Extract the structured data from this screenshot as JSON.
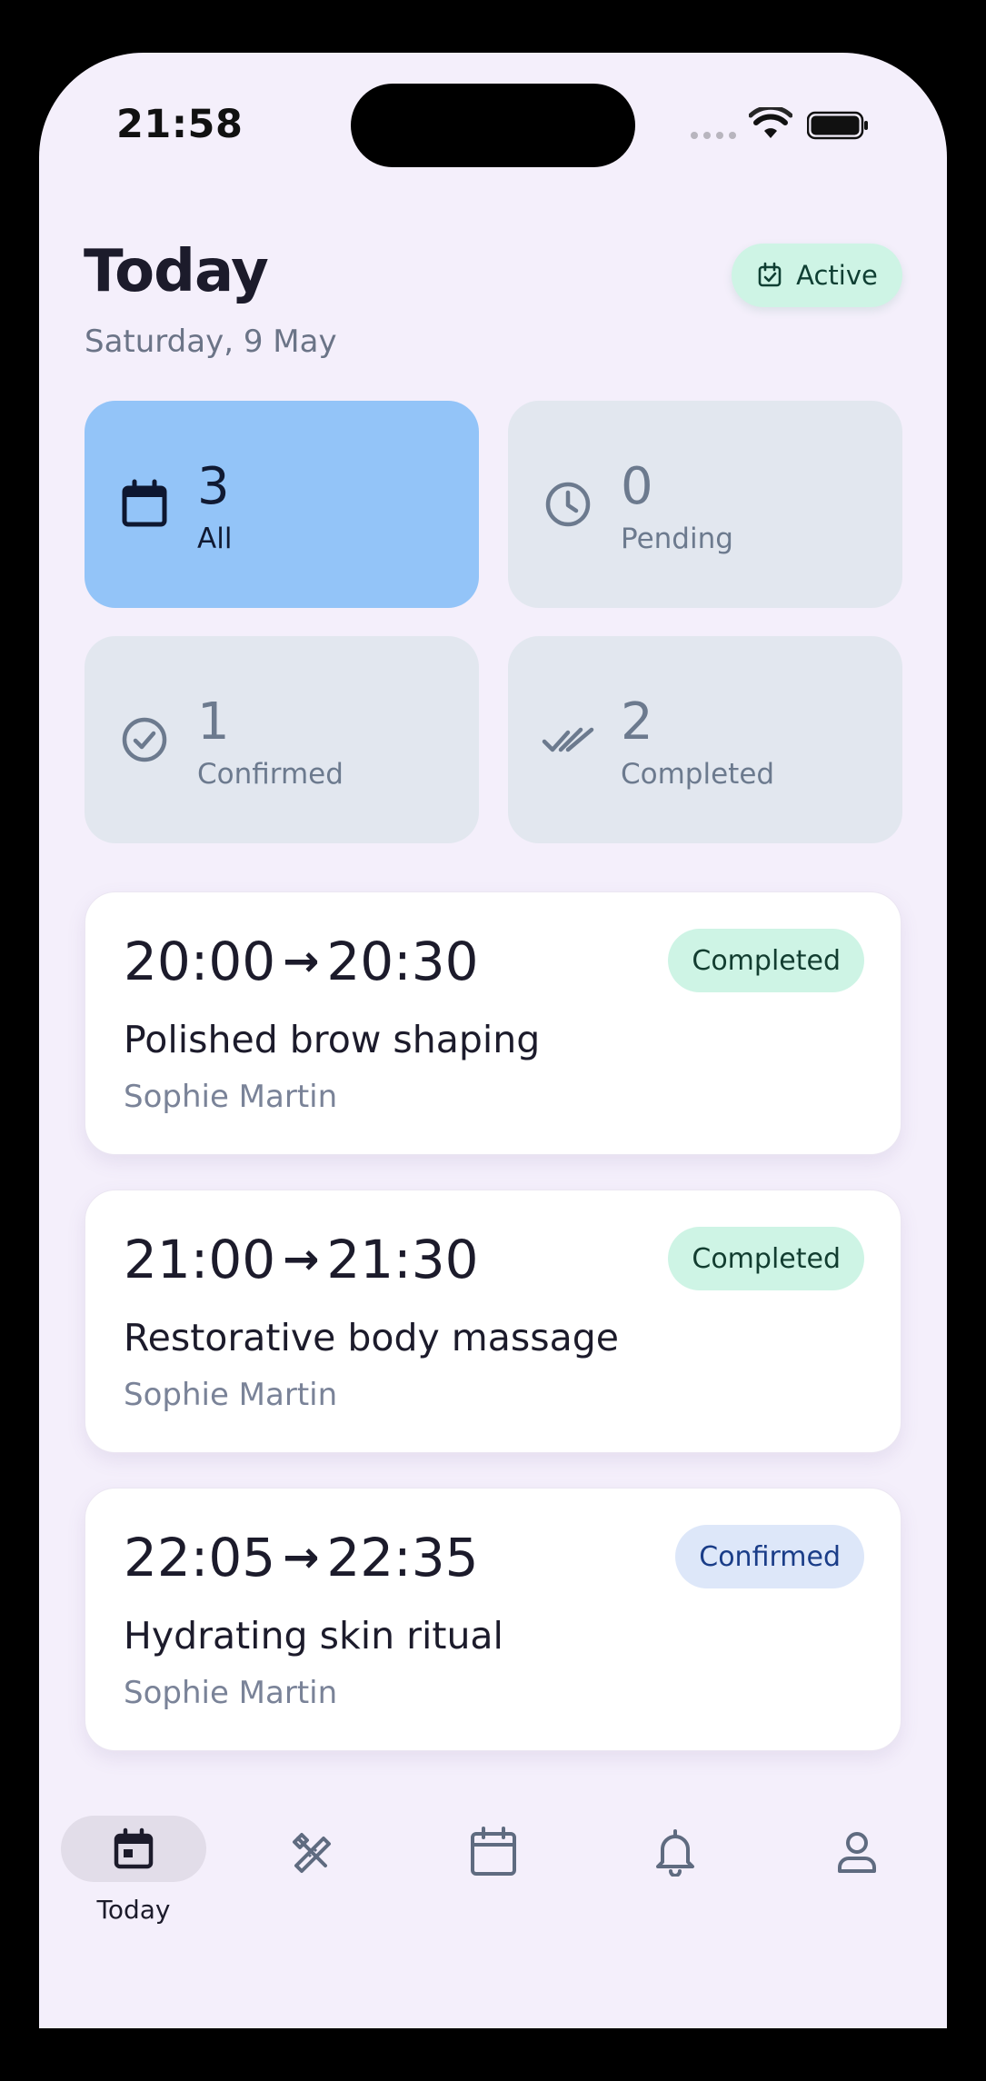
{
  "status_bar": {
    "time": "21:58"
  },
  "header": {
    "title": "Today",
    "date": "Saturday, 9 May",
    "status_pill": {
      "label": "Active",
      "icon": "calendar-check-icon"
    }
  },
  "stats": [
    {
      "count": "3",
      "label": "All",
      "icon": "calendar-icon",
      "selected": true
    },
    {
      "count": "0",
      "label": "Pending",
      "icon": "clock-icon",
      "selected": false
    },
    {
      "count": "1",
      "label": "Confirmed",
      "icon": "check-circle-icon",
      "selected": false
    },
    {
      "count": "2",
      "label": "Completed",
      "icon": "double-check-icon",
      "selected": false
    }
  ],
  "appointments": [
    {
      "start": "20:00",
      "end": "20:30",
      "arrow": "→",
      "service": "Polished brow shaping",
      "client": "Sophie Martin",
      "status": "Completed"
    },
    {
      "start": "21:00",
      "end": "21:30",
      "arrow": "→",
      "service": "Restorative body massage",
      "client": "Sophie Martin",
      "status": "Completed"
    },
    {
      "start": "22:05",
      "end": "22:35",
      "arrow": "→",
      "service": "Hydrating skin ritual",
      "client": "Sophie Martin",
      "status": "Confirmed"
    }
  ],
  "bottom_nav": [
    {
      "label": "Today",
      "icon": "calendar-today-icon",
      "active": true
    },
    {
      "label": "",
      "icon": "tools-icon",
      "active": false
    },
    {
      "label": "",
      "icon": "calendar-icon",
      "active": false
    },
    {
      "label": "",
      "icon": "bell-icon",
      "active": false
    },
    {
      "label": "",
      "icon": "user-icon",
      "active": false
    }
  ],
  "colors": {
    "screen_bg": "#f4effb",
    "selected_stat": "#93c4f8",
    "stat_bg": "#e2e7ef",
    "completed_badge": "#cef4e5",
    "confirmed_badge": "#dde7f9"
  }
}
